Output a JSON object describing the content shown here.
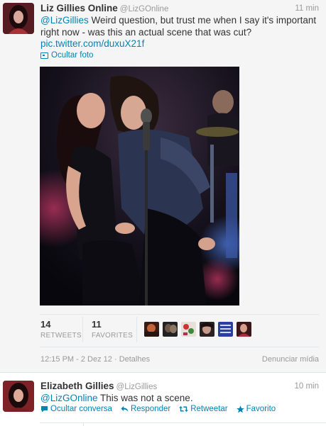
{
  "tweet1": {
    "fullname": "Liz Gillies Online",
    "handle": "@LizGOnline",
    "time": "11 min",
    "mention": "@LizGillies",
    "text": " Weird question, but trust me when I say it's important right now - was this an actual scene that was cut?",
    "pic_link": "pic.twitter.com/duxuX21f",
    "hide_photo": "Ocultar foto",
    "retweets_count": "14",
    "retweets_label": "RETWEETS",
    "favorites_count": "11",
    "favorites_label": "FAVORITES",
    "timestamp": "12:15 PM - 2 Dez 12",
    "details": "Detalhes",
    "report": "Denunciar mídia",
    "favoriters": [
      {
        "label": ""
      },
      {
        "label": ""
      },
      {
        "label": ""
      },
      {
        "label": ""
      },
      {
        "label": ""
      },
      {
        "label": ""
      }
    ]
  },
  "tweet2": {
    "fullname": "Elizabeth Gillies",
    "handle": "@LizGillies",
    "time": "10 min",
    "mention": "@LizGOnline",
    "text": " This was not a scene.",
    "actions": {
      "hide_conversation": "Ocultar conversa",
      "reply": "Responder",
      "retweet": "Retweetar",
      "favorite": "Favorito"
    }
  },
  "colors": {
    "link": "#0084b4",
    "muted": "#999999",
    "text": "#333333",
    "background_expanded": "#f5f5f5"
  },
  "separator": "·"
}
